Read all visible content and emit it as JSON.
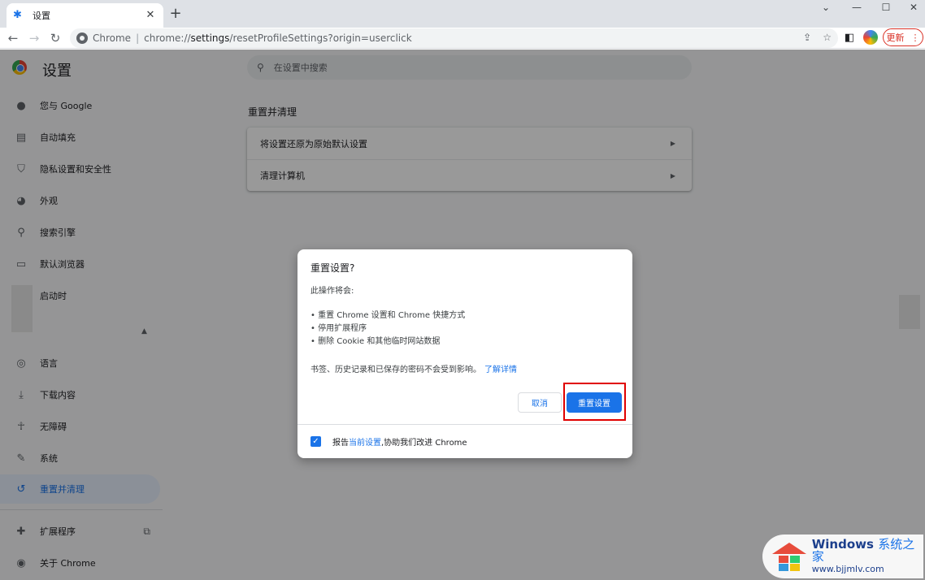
{
  "browser": {
    "tab_title": "设置",
    "url_site": "Chrome",
    "url_prefix": "chrome://",
    "url_host": "settings",
    "url_path": "/resetProfileSettings?origin=userclick",
    "update_label": "更新"
  },
  "settings": {
    "title": "设置",
    "search_placeholder": "在设置中搜索",
    "nav": [
      {
        "label": "您与 Google",
        "icon": "person-icon"
      },
      {
        "label": "自动填充",
        "icon": "clipboard-icon"
      },
      {
        "label": "隐私设置和安全性",
        "icon": "shield-icon"
      },
      {
        "label": "外观",
        "icon": "palette-icon"
      },
      {
        "label": "搜索引擎",
        "icon": "search-icon"
      },
      {
        "label": "默认浏览器",
        "icon": "browser-icon"
      },
      {
        "label": "启动时",
        "icon": "power-icon"
      },
      {
        "label": "语言",
        "icon": "globe-icon"
      },
      {
        "label": "下载内容",
        "icon": "download-icon"
      },
      {
        "label": "无障碍",
        "icon": "accessibility-icon"
      },
      {
        "label": "系统",
        "icon": "wrench-icon"
      },
      {
        "label": "重置并清理",
        "icon": "history-icon"
      },
      {
        "label": "扩展程序",
        "icon": "puzzle-icon"
      },
      {
        "label": "关于 Chrome",
        "icon": "chrome-icon"
      }
    ],
    "section_title": "重置并清理",
    "rows": [
      {
        "label": "将设置还原为原始默认设置"
      },
      {
        "label": "清理计算机"
      }
    ]
  },
  "dialog": {
    "title": "重置设置?",
    "intro": "此操作将会:",
    "items": [
      "重置 Chrome 设置和 Chrome 快捷方式",
      "停用扩展程序",
      "删除 Cookie 和其他临时网站数据"
    ],
    "note": "书签、历史记录和已保存的密码不会受到影响。",
    "learn_more": "了解详情",
    "cancel_label": "取消",
    "reset_label": "重置设置",
    "report_prefix": "报告",
    "report_link": "当前设置",
    "report_suffix": ",协助我们改进 Chrome",
    "report_checked": true
  },
  "watermark": {
    "brand": "Windows",
    "brand_cn": "系统之家",
    "url": "www.bjjmlv.com"
  },
  "colors": {
    "accent": "#1a73e8",
    "highlight": "#e00000",
    "update": "#d93025"
  }
}
